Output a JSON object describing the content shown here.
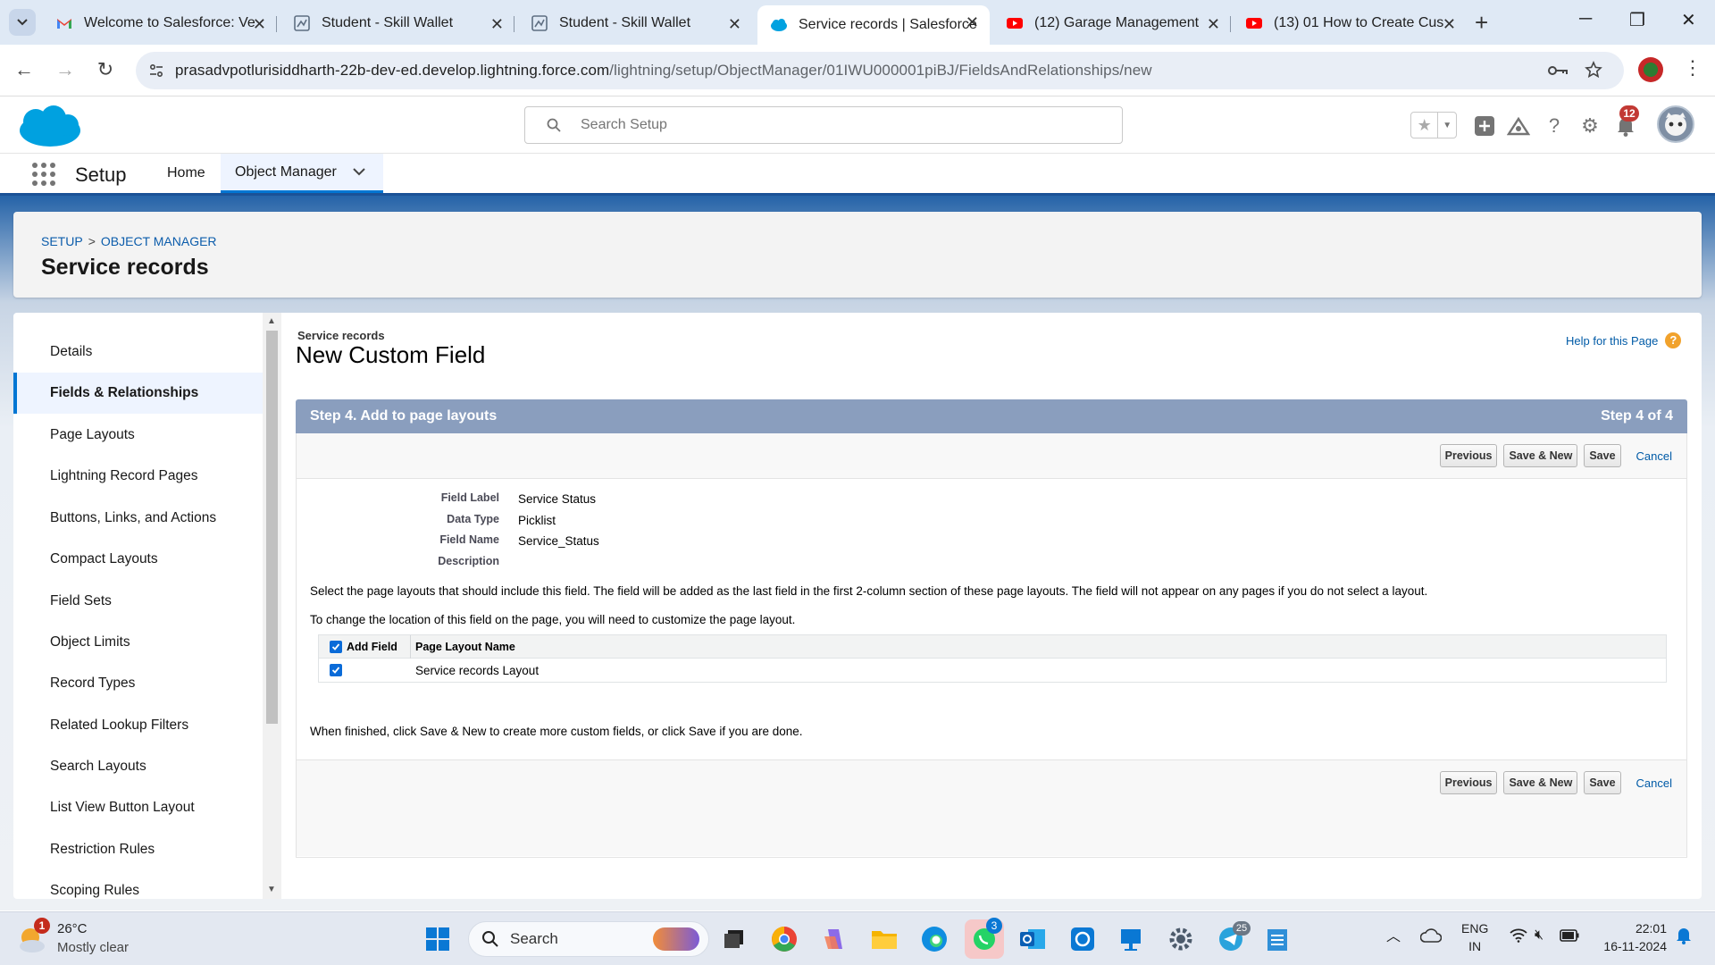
{
  "browser": {
    "tabs": [
      {
        "title": "Welcome to Salesforce: Ve",
        "favicon": "gmail-icon",
        "color": "#ea4335"
      },
      {
        "title": "Student - Skill Wallet",
        "favicon": "skill-wallet-icon",
        "color": "#5f6f82"
      },
      {
        "title": "Student - Skill Wallet",
        "favicon": "skill-wallet-icon",
        "color": "#5f6f82"
      },
      {
        "title": "Service records | Salesforce",
        "favicon": "salesforce-icon",
        "color": "#00a1e0"
      },
      {
        "title": "(12) Garage Management",
        "favicon": "youtube-icon",
        "color": "#ff0000"
      },
      {
        "title": "(13) 01 How to Create Cus",
        "favicon": "youtube-icon",
        "color": "#ff0000"
      }
    ],
    "url_host": "prasadvpotlurisiddharth-22b-dev-ed.develop.lightning.force.com",
    "url_path": "/lightning/setup/ObjectManager/01IWU000001piBJ/FieldsAndRelationships/new"
  },
  "sf_header": {
    "search_placeholder": "Search Setup",
    "notification_count": "12"
  },
  "sf_nav": {
    "app_name": "Setup",
    "items": [
      "Home",
      "Object Manager"
    ]
  },
  "page_header": {
    "crumb_setup": "SETUP",
    "crumb_sep": ">",
    "crumb_object_manager": "OBJECT MANAGER",
    "title": "Service records"
  },
  "left_nav": {
    "items": [
      "Details",
      "Fields & Relationships",
      "Page Layouts",
      "Lightning Record Pages",
      "Buttons, Links, and Actions",
      "Compact Layouts",
      "Field Sets",
      "Object Limits",
      "Record Types",
      "Related Lookup Filters",
      "Search Layouts",
      "List View Button Layout",
      "Restriction Rules",
      "Scoping Rules"
    ],
    "active": "Fields & Relationships"
  },
  "main": {
    "object_name": "Service records",
    "title": "New Custom Field",
    "help_link": "Help for this Page",
    "step_title": "Step 4. Add to page layouts",
    "step_count": "Step 4 of 4",
    "buttons": {
      "previous": "Previous",
      "save_new": "Save & New",
      "save": "Save",
      "cancel": "Cancel"
    },
    "details": [
      {
        "label": "Field Label",
        "value": "Service Status"
      },
      {
        "label": "Data Type",
        "value": "Picklist"
      },
      {
        "label": "Field Name",
        "value": "Service_Status"
      },
      {
        "label": "Description",
        "value": ""
      }
    ],
    "para1": "Select the page layouts that should include this field. The field will be added as the last field in the first 2-column section of these page layouts. The field will not appear on any pages if you do not select a layout.",
    "para2": "To change the location of this field on the page, you will need to customize the page layout.",
    "layout_table": {
      "headers": [
        "Add Field",
        "Page Layout Name"
      ],
      "rows": [
        {
          "checked": true,
          "name": "Service records Layout"
        }
      ],
      "header_checked": true
    },
    "para3": "When finished, click Save & New to create more custom fields, or click Save if you are done."
  },
  "taskbar": {
    "weather_temp": "26°C",
    "weather_desc": "Mostly clear",
    "weather_badge": "1",
    "search_label": "Search",
    "whatsapp_badge": "3",
    "telegram_badge": "25",
    "lang_top": "ENG",
    "lang_bottom": "IN",
    "time": "22:01",
    "date": "16-11-2024"
  }
}
